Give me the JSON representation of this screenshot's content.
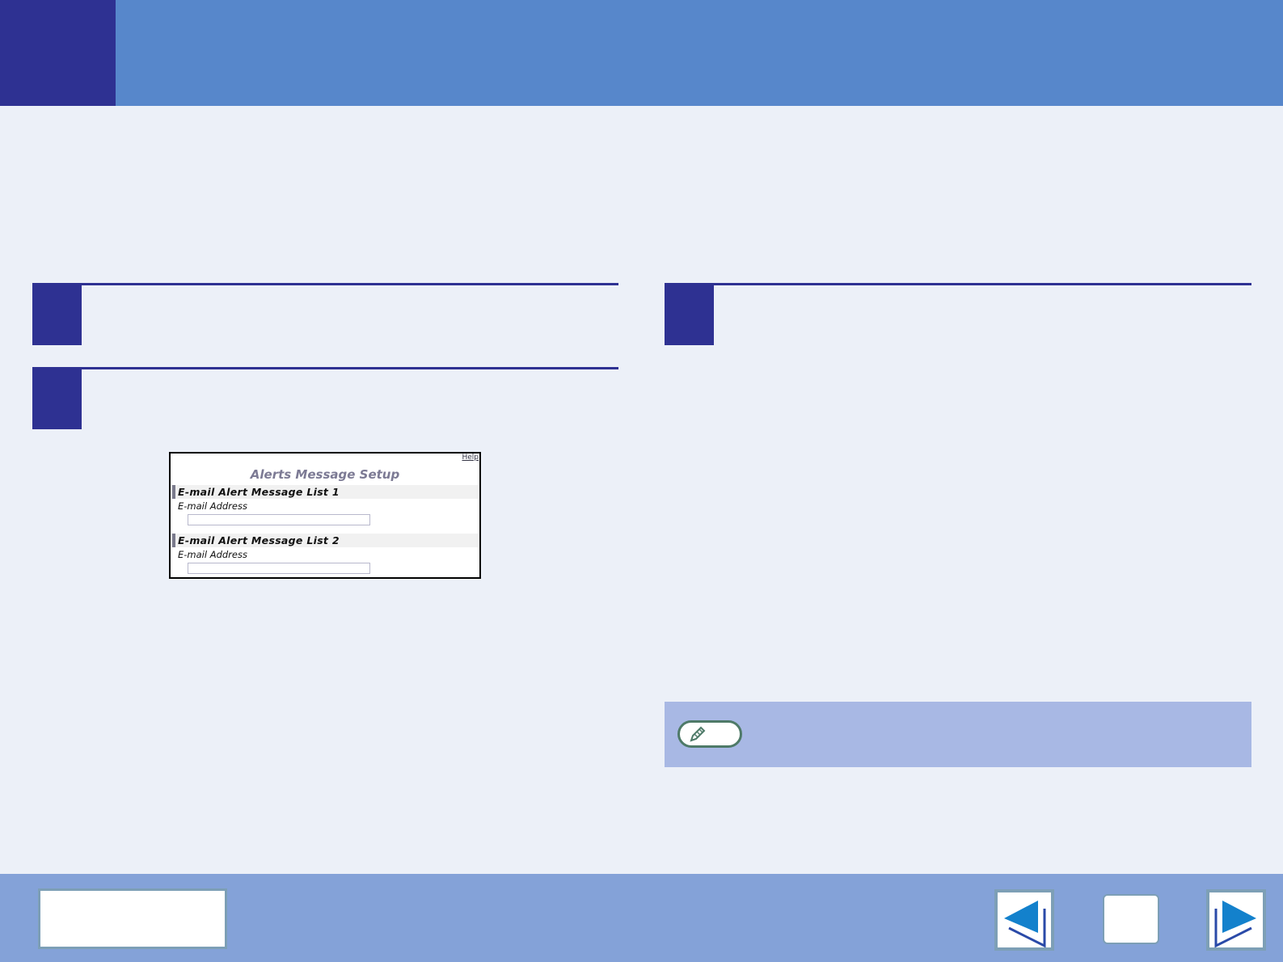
{
  "screenshot": {
    "help_link": "Help",
    "title": "Alerts Message Setup",
    "sections": [
      {
        "heading": "E-mail Alert Message List 1",
        "field_label": "E-mail Address",
        "value": ""
      },
      {
        "heading": "E-mail Alert Message List 2",
        "field_label": "E-mail Address",
        "value": ""
      }
    ]
  },
  "colors": {
    "header": "#5787cb",
    "accent": "#2e3192",
    "footer": "#84a2d8",
    "note": "#a8b8e4"
  },
  "icons": {
    "note": "pencil-icon",
    "prev": "arrow-left-icon",
    "next": "arrow-right-icon"
  }
}
